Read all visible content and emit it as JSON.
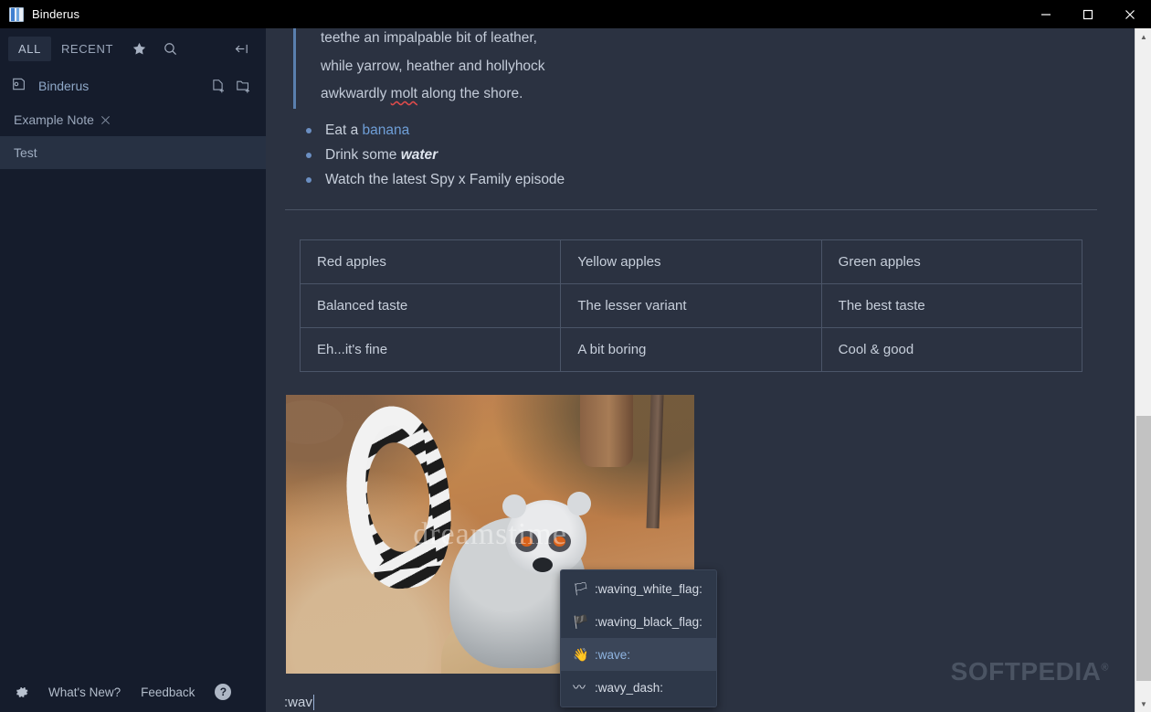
{
  "window": {
    "title": "Binderus",
    "app_icon": "binder-icon",
    "controls": {
      "minimize": "minimize-icon",
      "maximize": "maximize-icon",
      "close": "close-icon"
    }
  },
  "sidebar": {
    "tabs": [
      {
        "label": "ALL",
        "active": true
      },
      {
        "label": "RECENT",
        "active": false
      }
    ],
    "toolbar_icons": [
      {
        "name": "favorites-star-icon",
        "glyph": "star"
      },
      {
        "name": "search-icon",
        "glyph": "magnifier"
      },
      {
        "name": "collapse-sidebar-icon",
        "glyph": "arrow-to-line-left"
      }
    ],
    "folder": {
      "icon": "binder-folder-icon",
      "name": "Binderus",
      "actions": [
        {
          "name": "new-note-icon",
          "glyph": "file-plus"
        },
        {
          "name": "new-folder-icon",
          "glyph": "folder-plus"
        }
      ]
    },
    "open_note_tab": {
      "label": "Example Note",
      "close_glyph": "×"
    },
    "notes": [
      {
        "label": "Test",
        "selected": true
      }
    ],
    "footer": {
      "settings_icon": "gear-icon",
      "links": [
        "What's New?",
        "Feedback"
      ],
      "help_icon": "help-icon",
      "help_glyph": "?"
    }
  },
  "editor": {
    "blockquote": {
      "lines": [
        "teethe an impalpable bit of leather,",
        "while yarrow, heather and hollyhock",
        "awkwardly molt along the shore."
      ],
      "misspelled_word": "molt"
    },
    "bullets": [
      {
        "prefix": "Eat a ",
        "link": "banana",
        "suffix": ""
      },
      {
        "prefix": "Drink some ",
        "emphasis": "water",
        "suffix": ""
      },
      {
        "prefix": "Watch the latest Spy x Family episode",
        "suffix": ""
      }
    ],
    "table": {
      "rows": [
        [
          "Red apples",
          "Yellow apples",
          "Green apples"
        ],
        [
          "Balanced taste",
          "The lesser variant",
          "The best taste"
        ],
        [
          "Eh...it's fine",
          "A bit boring",
          "Cool & good"
        ]
      ]
    },
    "image": {
      "name": "lemur-photo",
      "alt": "Ring-tailed lemur standing on a rock on reddish dirt",
      "watermark": "dreamstime"
    },
    "input": {
      "value": ":wav",
      "placeholder": ""
    }
  },
  "emoji_popup": {
    "items": [
      {
        "glyph": "🏳",
        "label": ":waving_white_flag:",
        "selected": false
      },
      {
        "glyph": "🏴",
        "label": ":waving_black_flag:",
        "selected": false
      },
      {
        "glyph": "👋",
        "label": ":wave:",
        "selected": true
      },
      {
        "glyph": "〰",
        "label": ":wavy_dash:",
        "selected": false
      }
    ]
  },
  "watermark": {
    "text": "SOFTPEDIA",
    "mark": "®"
  },
  "scrollbar": {
    "up_glyph": "▲",
    "down_glyph": "▼",
    "position_percent": 58
  },
  "colors": {
    "titlebar": "#000000",
    "sidebar_bg": "#151c2c",
    "editor_bg": "#2b3241",
    "accent_link": "#6f9fd8",
    "quote_bar": "#5a7fae",
    "selected_row": "#273143",
    "spell_error": "#e04b4b"
  }
}
